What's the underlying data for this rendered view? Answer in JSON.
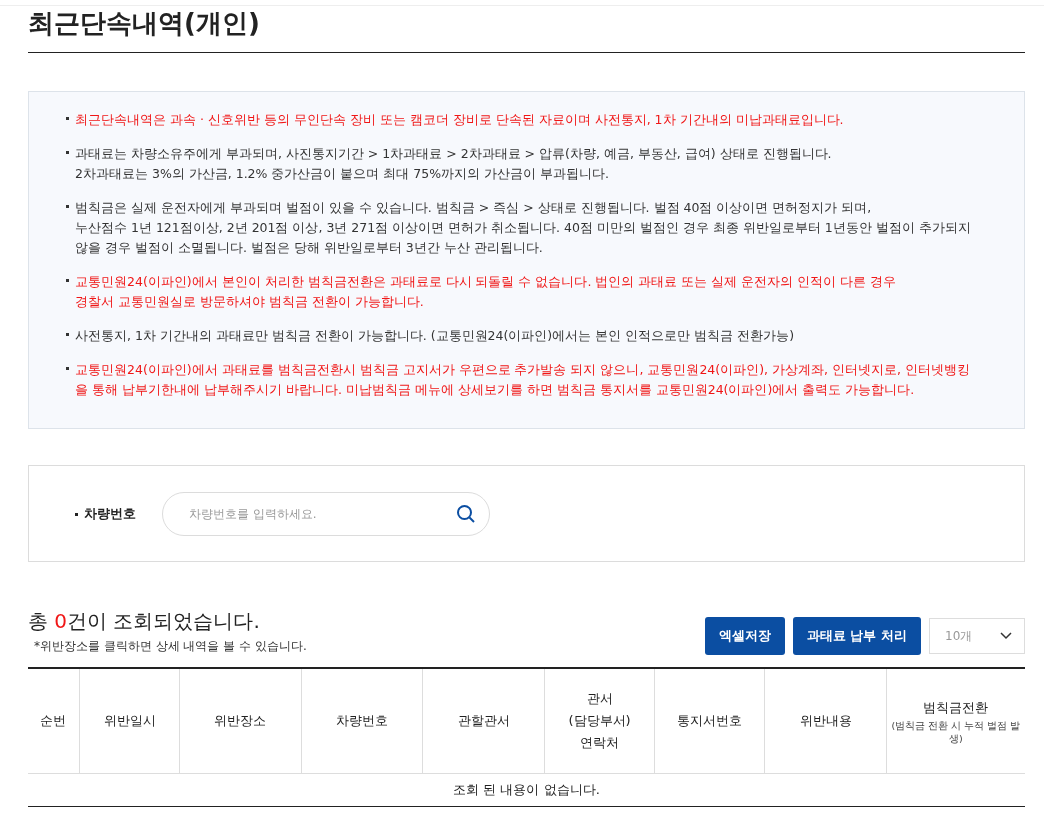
{
  "title": "최근단속내역(개인)",
  "notices": [
    {
      "highlighted": true,
      "lines": [
        "최근단속내역은 과속 · 신호위반 등의 무인단속 장비 또는 캠코더 장비로 단속된 자료이며 사전통지, 1차 기간내의 미납과태료입니다."
      ]
    },
    {
      "highlighted": false,
      "lines": [
        "과태료는 차량소유주에게 부과되며, 사진통지기간 > 1차과태료 > 2차과태료 > 압류(차량, 예금, 부동산, 급여) 상태로 진행됩니다.",
        "2차과태료는 3%의 가산금, 1.2% 중가산금이 붙으며 최대 75%까지의 가산금이 부과됩니다."
      ]
    },
    {
      "highlighted": false,
      "lines": [
        "범칙금은 실제 운전자에게 부과되며 벌점이 있을 수 있습니다. 범칙금 > 즉심 > 상태로 진행됩니다. 벌점 40점 이상이면 면허정지가 되며,",
        "누산점수 1년 121점이상, 2년 201점 이상, 3년 271점 이상이면 면허가 취소됩니다. 40점 미만의 벌점인 경우 최종 위반일로부터 1년동안 벌점이 추가되지",
        "않을 경우 벌점이 소멸됩니다. 벌점은 당해 위반일로부터 3년간 누산 관리됩니다."
      ]
    },
    {
      "highlighted": true,
      "lines": [
        "교통민원24(이파인)에서 본인이 처리한 범칙금전환은 과태료로 다시 되돌릴 수 없습니다. 법인의 과태료 또는 실제 운전자의 인적이 다른 경우",
        "경찰서 교통민원실로 방문하셔야 범칙금 전환이 가능합니다."
      ]
    },
    {
      "highlighted": false,
      "lines": [
        "사전통지, 1차 기간내의 과태료만 범칙금 전환이 가능합니다. (교통민원24(이파인)에서는 본인 인적으로만 범칙금 전환가능)"
      ]
    },
    {
      "highlighted": true,
      "lines": [
        "교통민원24(이파인)에서 과태료를 범칙금전환시 범칙금 고지서가 우편으로 추가발송 되지 않으니, 교통민원24(이파인), 가상계좌, 인터넷지로, 인터넷뱅킹",
        "을 통해 납부기한내에 납부해주시기 바랍니다. 미납범칙금 메뉴에 상세보기를 하면 범칙금 통지서를 교통민원24(이파인)에서 출력도 가능합니다."
      ]
    }
  ],
  "search": {
    "label": "차량번호",
    "placeholder": "차량번호를 입력하세요."
  },
  "result": {
    "prefix": "총 ",
    "count": "0",
    "suffix": "건이 조회되었습니다.",
    "hint": "*위반장소를 클릭하면 상세 내역을 볼 수 있습니다."
  },
  "buttons": [
    "엑셀저장",
    "과태료 납부 처리"
  ],
  "page_size": "10개",
  "table": {
    "columns": [
      {
        "lines": [
          "순번"
        ]
      },
      {
        "lines": [
          "위반일시"
        ]
      },
      {
        "lines": [
          "위반장소"
        ]
      },
      {
        "lines": [
          "차량번호"
        ]
      },
      {
        "lines": [
          "관할관서"
        ]
      },
      {
        "lines": [
          "관서",
          "(담당부서)",
          "연락처"
        ]
      },
      {
        "lines": [
          "통지서번호"
        ]
      },
      {
        "lines": [
          "위반내용"
        ]
      },
      {
        "lines": [
          "범칙금전환"
        ],
        "note": "(범칙금 전환 시 누적 벌점 발생)"
      }
    ],
    "empty": "조회 된 내용이 없습니다."
  }
}
